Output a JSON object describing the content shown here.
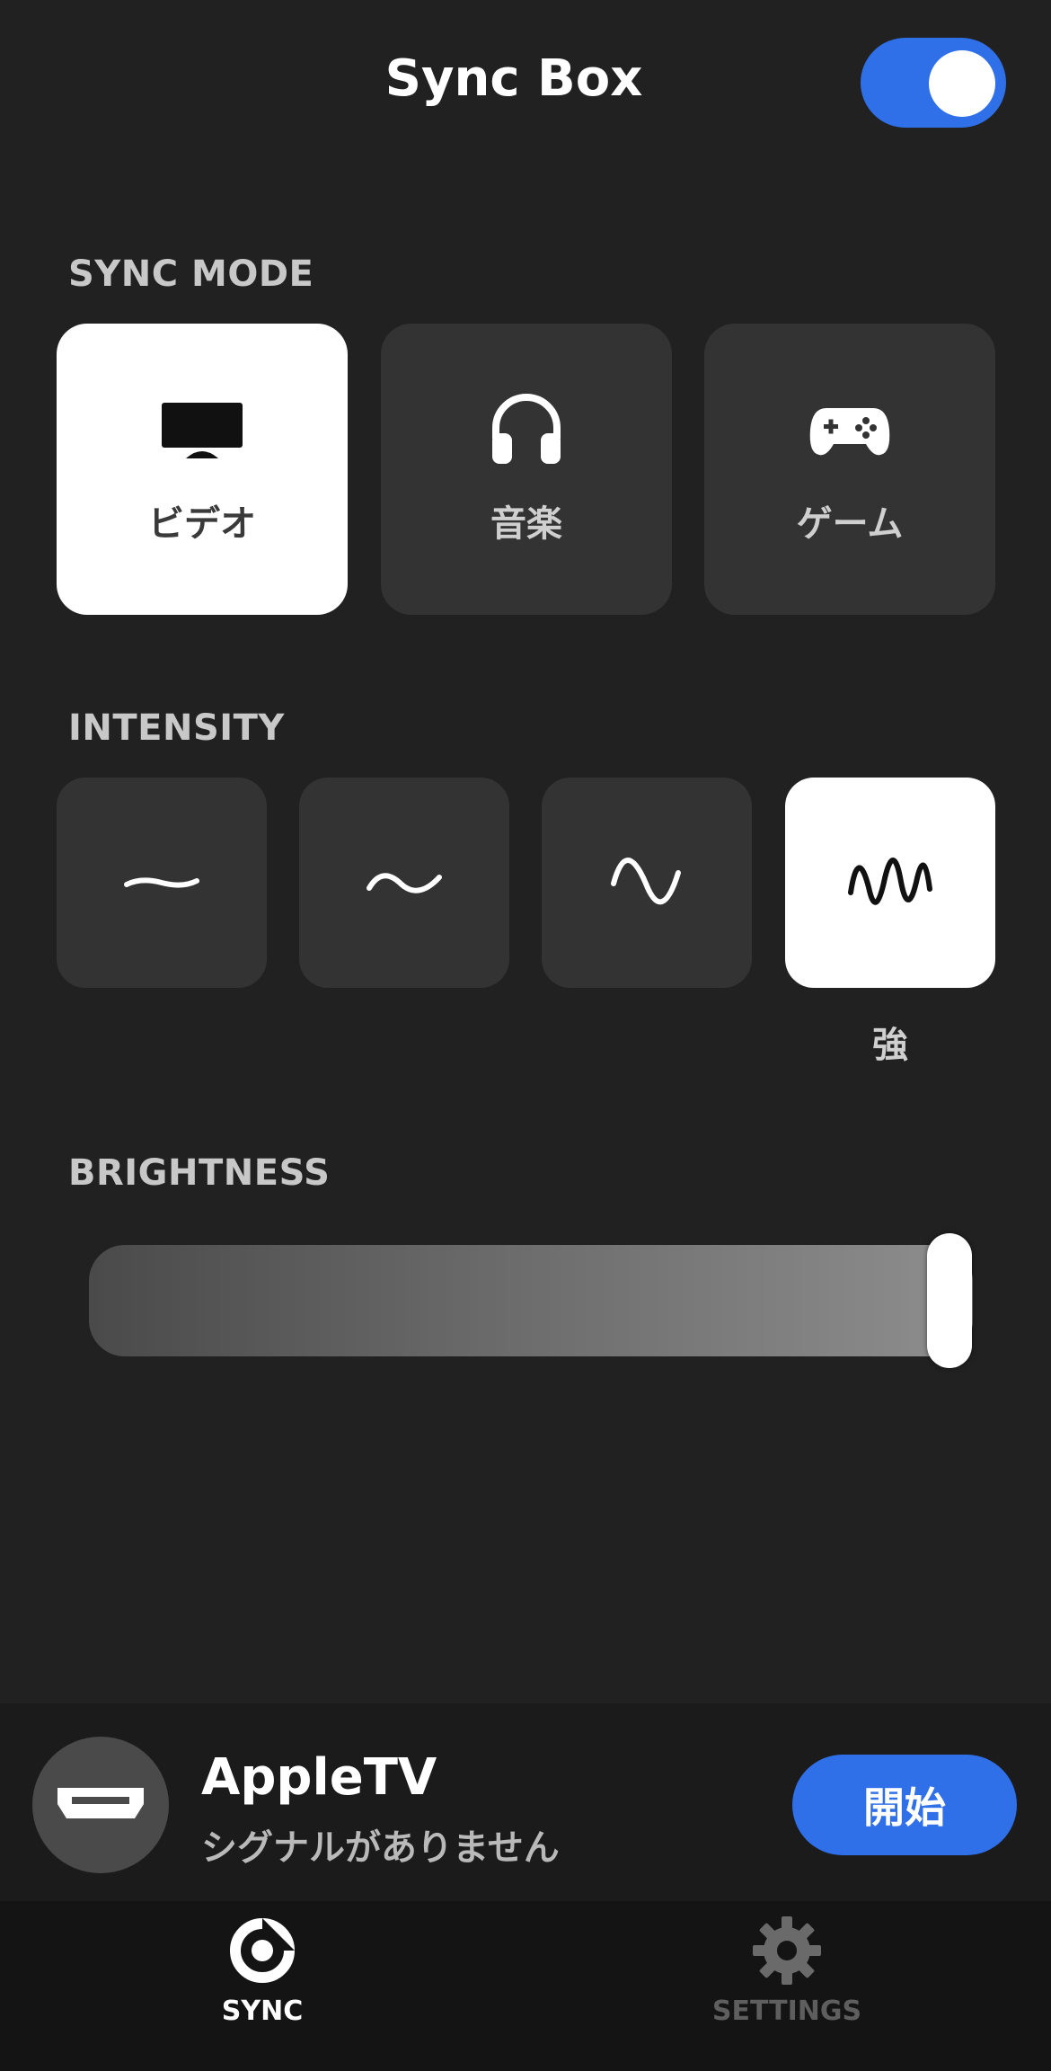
{
  "header": {
    "title": "Sync Box",
    "power_on": true
  },
  "sync_mode": {
    "label": "SYNC MODE",
    "options": [
      {
        "label": "ビデオ",
        "icon": "tv-icon",
        "selected": true
      },
      {
        "label": "音楽",
        "icon": "headphones-icon",
        "selected": false
      },
      {
        "label": "ゲーム",
        "icon": "gamepad-icon",
        "selected": false
      }
    ]
  },
  "intensity": {
    "label": "INTENSITY",
    "levels": [
      {
        "icon": "wave-subtle-icon",
        "selected": false
      },
      {
        "icon": "wave-moderate-icon",
        "selected": false
      },
      {
        "icon": "wave-high-icon",
        "selected": false
      },
      {
        "icon": "wave-intense-icon",
        "selected": true
      }
    ],
    "selected_label": "強"
  },
  "brightness": {
    "label": "BRIGHTNESS",
    "value_fraction": 1.0
  },
  "device": {
    "name": "AppleTV",
    "status": "シグナルがありません",
    "icon": "hdmi-icon",
    "start_label": "開始"
  },
  "tabs": [
    {
      "label": "SYNC",
      "icon": "sync-icon",
      "active": true
    },
    {
      "label": "SETTINGS",
      "icon": "gear-icon",
      "active": false
    }
  ],
  "colors": {
    "accent": "#2f6fe8",
    "background": "#212121",
    "card": "#333333"
  }
}
